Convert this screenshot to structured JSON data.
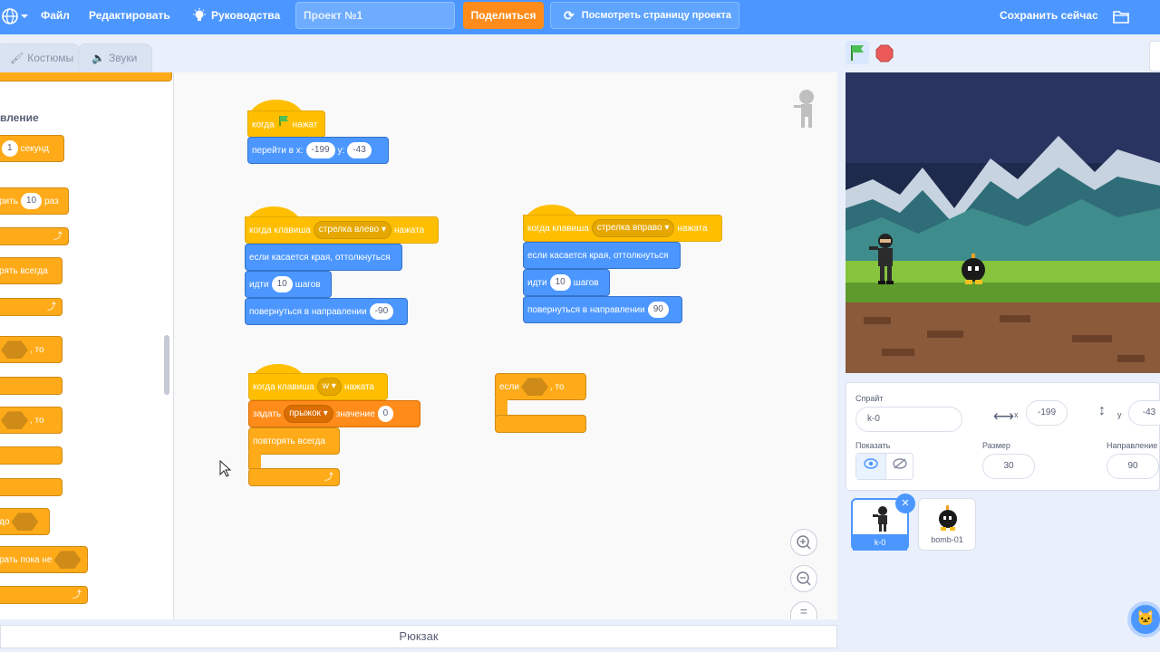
{
  "menubar": {
    "file": "Файл",
    "edit": "Редактировать",
    "tutorials": "Руководства",
    "project_title": "Проект №1",
    "share": "Поделиться",
    "view_page": "Посмотреть страницу проекта",
    "save_now": "Сохранить сейчас"
  },
  "tabs": {
    "costumes": "Костюмы",
    "sounds": "Звуки"
  },
  "palette": {
    "category": "вление",
    "wait_value": "1",
    "wait_label": "секунд",
    "repeat_label": "рить",
    "repeat_value": "10",
    "repeat_suffix": "раз",
    "forever_label": "рять всегда",
    "if_then_label": ", то",
    "if_then2_label": ", то",
    "until_label": "до",
    "repeat_until_label": "рать пока не"
  },
  "scripts": {
    "s1": {
      "hat": "когда",
      "hat_suffix": "нажат",
      "goto_label": "перейти в x:",
      "x": "-199",
      "y_label": "y:",
      "y": "-43"
    },
    "s2": {
      "hat_prefix": "когда клавиша",
      "key": "стрелка влево",
      "hat_suffix": "нажата",
      "bounce": "если касается края, оттолкнуться",
      "move_label": "идти",
      "steps": "10",
      "steps_label": "шагов",
      "dir_label": "повернуться в направлении",
      "dir": "-90"
    },
    "s3": {
      "hat_prefix": "когда клавиша",
      "key": "стрелка вправо",
      "hat_suffix": "нажата",
      "bounce": "если касается края, оттолкнуться",
      "move_label": "идти",
      "steps": "10",
      "steps_label": "шагов",
      "dir_label": "повернуться в направлении",
      "dir": "90"
    },
    "s4": {
      "hat_prefix": "когда клавиша",
      "key": "w",
      "hat_suffix": "нажата",
      "set_label": "задать",
      "var": "прыжок",
      "value_label": "значение",
      "value": "0",
      "forever": "повторять всегда"
    },
    "s5": {
      "if_label": "если",
      "then_label": ", то"
    }
  },
  "backpack": "Рюкзак",
  "sprite_info": {
    "sprite_label": "Спрайт",
    "sprite_name": "k-0",
    "x_label": "x",
    "x": "-199",
    "y_label": "y",
    "y": "-43",
    "show_label": "Показать",
    "size_label": "Размер",
    "size": "30",
    "direction_label": "Направление",
    "direction": "90"
  },
  "sprites": [
    {
      "name": "k-0"
    },
    {
      "name": "bomb-01"
    }
  ],
  "colors": {
    "accent": "#4c97ff",
    "events": "#ffbf00",
    "motion": "#4c97ff",
    "control": "#ffab19",
    "variables": "#ff8c1a"
  }
}
